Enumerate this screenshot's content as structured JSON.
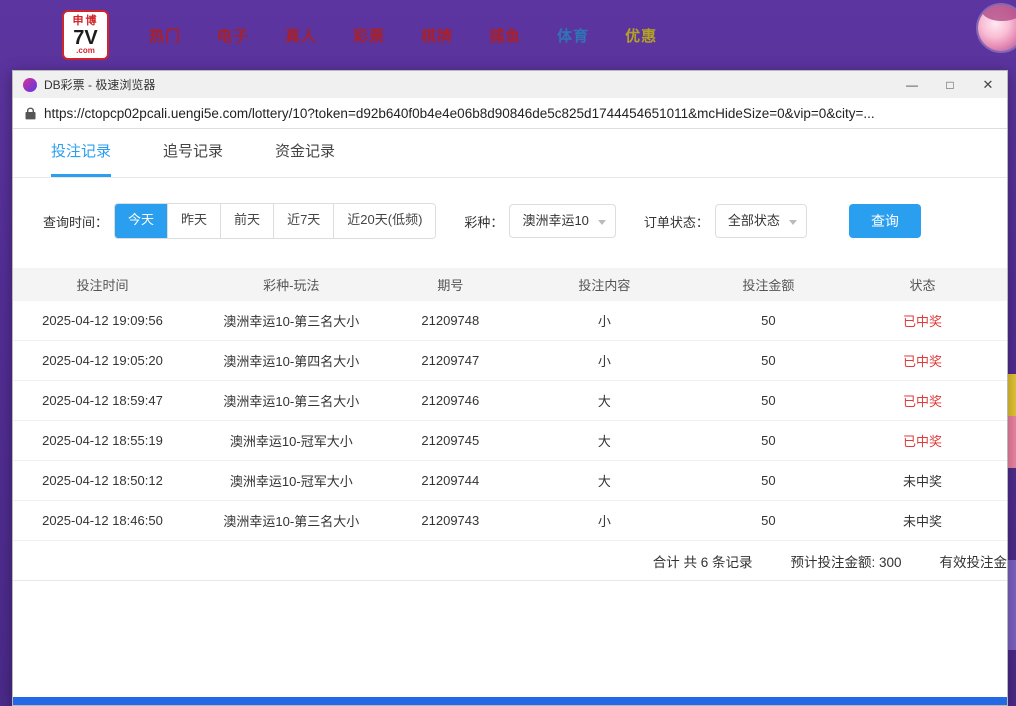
{
  "top_nav": {
    "logo": {
      "cn": "申博",
      "brand": "7V",
      "tld": ".com"
    },
    "items": [
      {
        "label": "热门"
      },
      {
        "label": "电子"
      },
      {
        "label": "真人"
      },
      {
        "label": "彩票"
      },
      {
        "label": "棋牌"
      },
      {
        "label": "捕鱼"
      },
      {
        "label": "体育"
      },
      {
        "label": "优惠"
      }
    ]
  },
  "browser": {
    "title": "DB彩票 - 极速浏览器",
    "minimize_glyph": "—",
    "maximize_glyph": "□",
    "close_glyph": "✕",
    "url": "https://ctopcp02pcali.uengi5e.com/lottery/10?token=d92b640f0b4e4e06b8d90846de5c825d1744454651011&mcHideSize=0&vip=0&city=..."
  },
  "tabs": [
    {
      "label": "投注记录"
    },
    {
      "label": "追号记录"
    },
    {
      "label": "资金记录"
    }
  ],
  "filters": {
    "time_label": "查询时间：",
    "time_options": [
      "今天",
      "昨天",
      "前天",
      "近7天",
      "近20天(低频)"
    ],
    "lottery_label": "彩种：",
    "lottery_value": "澳洲幸运10",
    "status_label": "订单状态：",
    "status_value": "全部状态",
    "query_label": "查询"
  },
  "table": {
    "headers": [
      "投注时间",
      "彩种-玩法",
      "期号",
      "投注内容",
      "投注金额",
      "状态"
    ],
    "win_text": "已中奖",
    "win_color": "#e03a3a",
    "rows": [
      [
        "2025-04-12 19:09:56",
        "澳洲幸运10-第三名大小",
        "21209748",
        "小",
        "50",
        "已中奖"
      ],
      [
        "2025-04-12 19:05:20",
        "澳洲幸运10-第四名大小",
        "21209747",
        "小",
        "50",
        "已中奖"
      ],
      [
        "2025-04-12 18:59:47",
        "澳洲幸运10-第三名大小",
        "21209746",
        "大",
        "50",
        "已中奖"
      ],
      [
        "2025-04-12 18:55:19",
        "澳洲幸运10-冠军大小",
        "21209745",
        "大",
        "50",
        "已中奖"
      ],
      [
        "2025-04-12 18:50:12",
        "澳洲幸运10-冠军大小",
        "21209744",
        "大",
        "50",
        "未中奖"
      ],
      [
        "2025-04-12 18:46:50",
        "澳洲幸运10-第三名大小",
        "21209743",
        "小",
        "50",
        "未中奖"
      ]
    ]
  },
  "summary": {
    "total": "合计 共 6 条记录",
    "expected": "预计投注金额: 300",
    "valid": "有效投注金"
  },
  "colors": {
    "accent_blue": "#2a9ff0",
    "nav_red": "#a8202a",
    "nav_blue": "#2f75b5",
    "nav_gold": "#b3a125"
  }
}
